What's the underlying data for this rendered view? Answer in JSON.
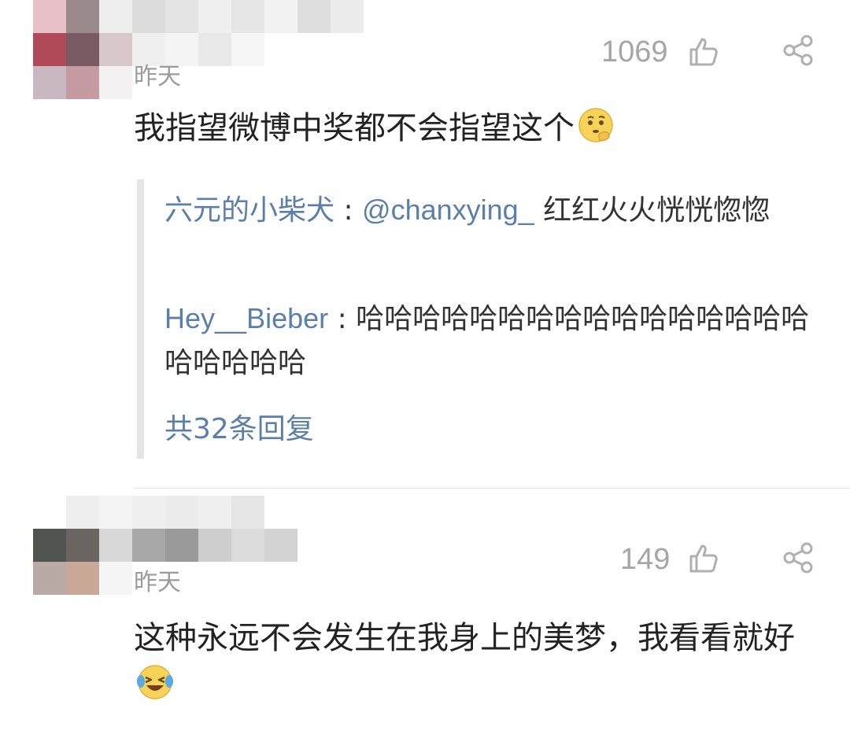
{
  "comments": [
    {
      "time": "昨天",
      "likes": "1069",
      "text": "我指望微博中奖都不会指望这个",
      "emoji": "thinking-face-emoji",
      "replies": [
        {
          "user": "六元的小柴犬",
          "sep": " : ",
          "mention": "@chanxying_",
          "text": " 红红火火恍恍惚惚"
        },
        {
          "user": "Hey__Bieber",
          "sep": " : ",
          "text": "哈哈哈哈哈哈哈哈哈哈哈哈哈哈哈哈哈哈哈哈哈"
        }
      ],
      "more_replies": "共32条回复"
    },
    {
      "time": "昨天",
      "likes": "149",
      "text": "这种永远不会发生在我身上的美梦，我看看就好",
      "emoji": "laughing-tears-emoji"
    }
  ],
  "colors": {
    "link": "#5b7fa9",
    "meta": "#9b9b9b",
    "body_text": "#222222",
    "divider": "#e3e3e3"
  }
}
